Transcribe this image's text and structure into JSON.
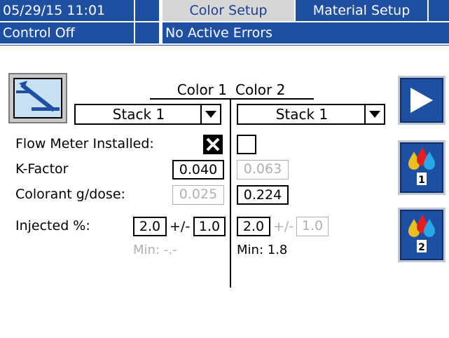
{
  "status_bar": {
    "datetime": "05/29/15 11:01",
    "tabs": [
      "Color Setup",
      "Material Setup"
    ],
    "control_state": "Control Off",
    "error_text": "No Active Errors"
  },
  "columns": {
    "color1_header": "Color 1",
    "color2_header": "Color 2",
    "color1_stack": "Stack 1",
    "color2_stack": "Stack 1"
  },
  "rows": {
    "flow_meter_label": "Flow Meter Installed:",
    "kfactor_label": "K-Factor",
    "colorant_label": "Colorant g/dose:",
    "injected_label": "Injected %:"
  },
  "color1": {
    "flow_meter_installed": true,
    "kfactor": "0.040",
    "colorant": "0.025",
    "injected": "2.0",
    "tolerance_sep": "+/-",
    "tolerance": "1.0",
    "min": "Min: -.-"
  },
  "color2": {
    "flow_meter_installed": false,
    "kfactor": "0.063",
    "colorant": "0.224",
    "injected": "2.0",
    "tolerance_sep": "+/-",
    "tolerance": "1.0",
    "min": "Min: 1.8"
  },
  "side_buttons": {
    "color1_number": "1",
    "color2_number": "2"
  },
  "colors": {
    "header_blue": "#1f4fa1",
    "disabled_gray": "#b0b0b0"
  }
}
